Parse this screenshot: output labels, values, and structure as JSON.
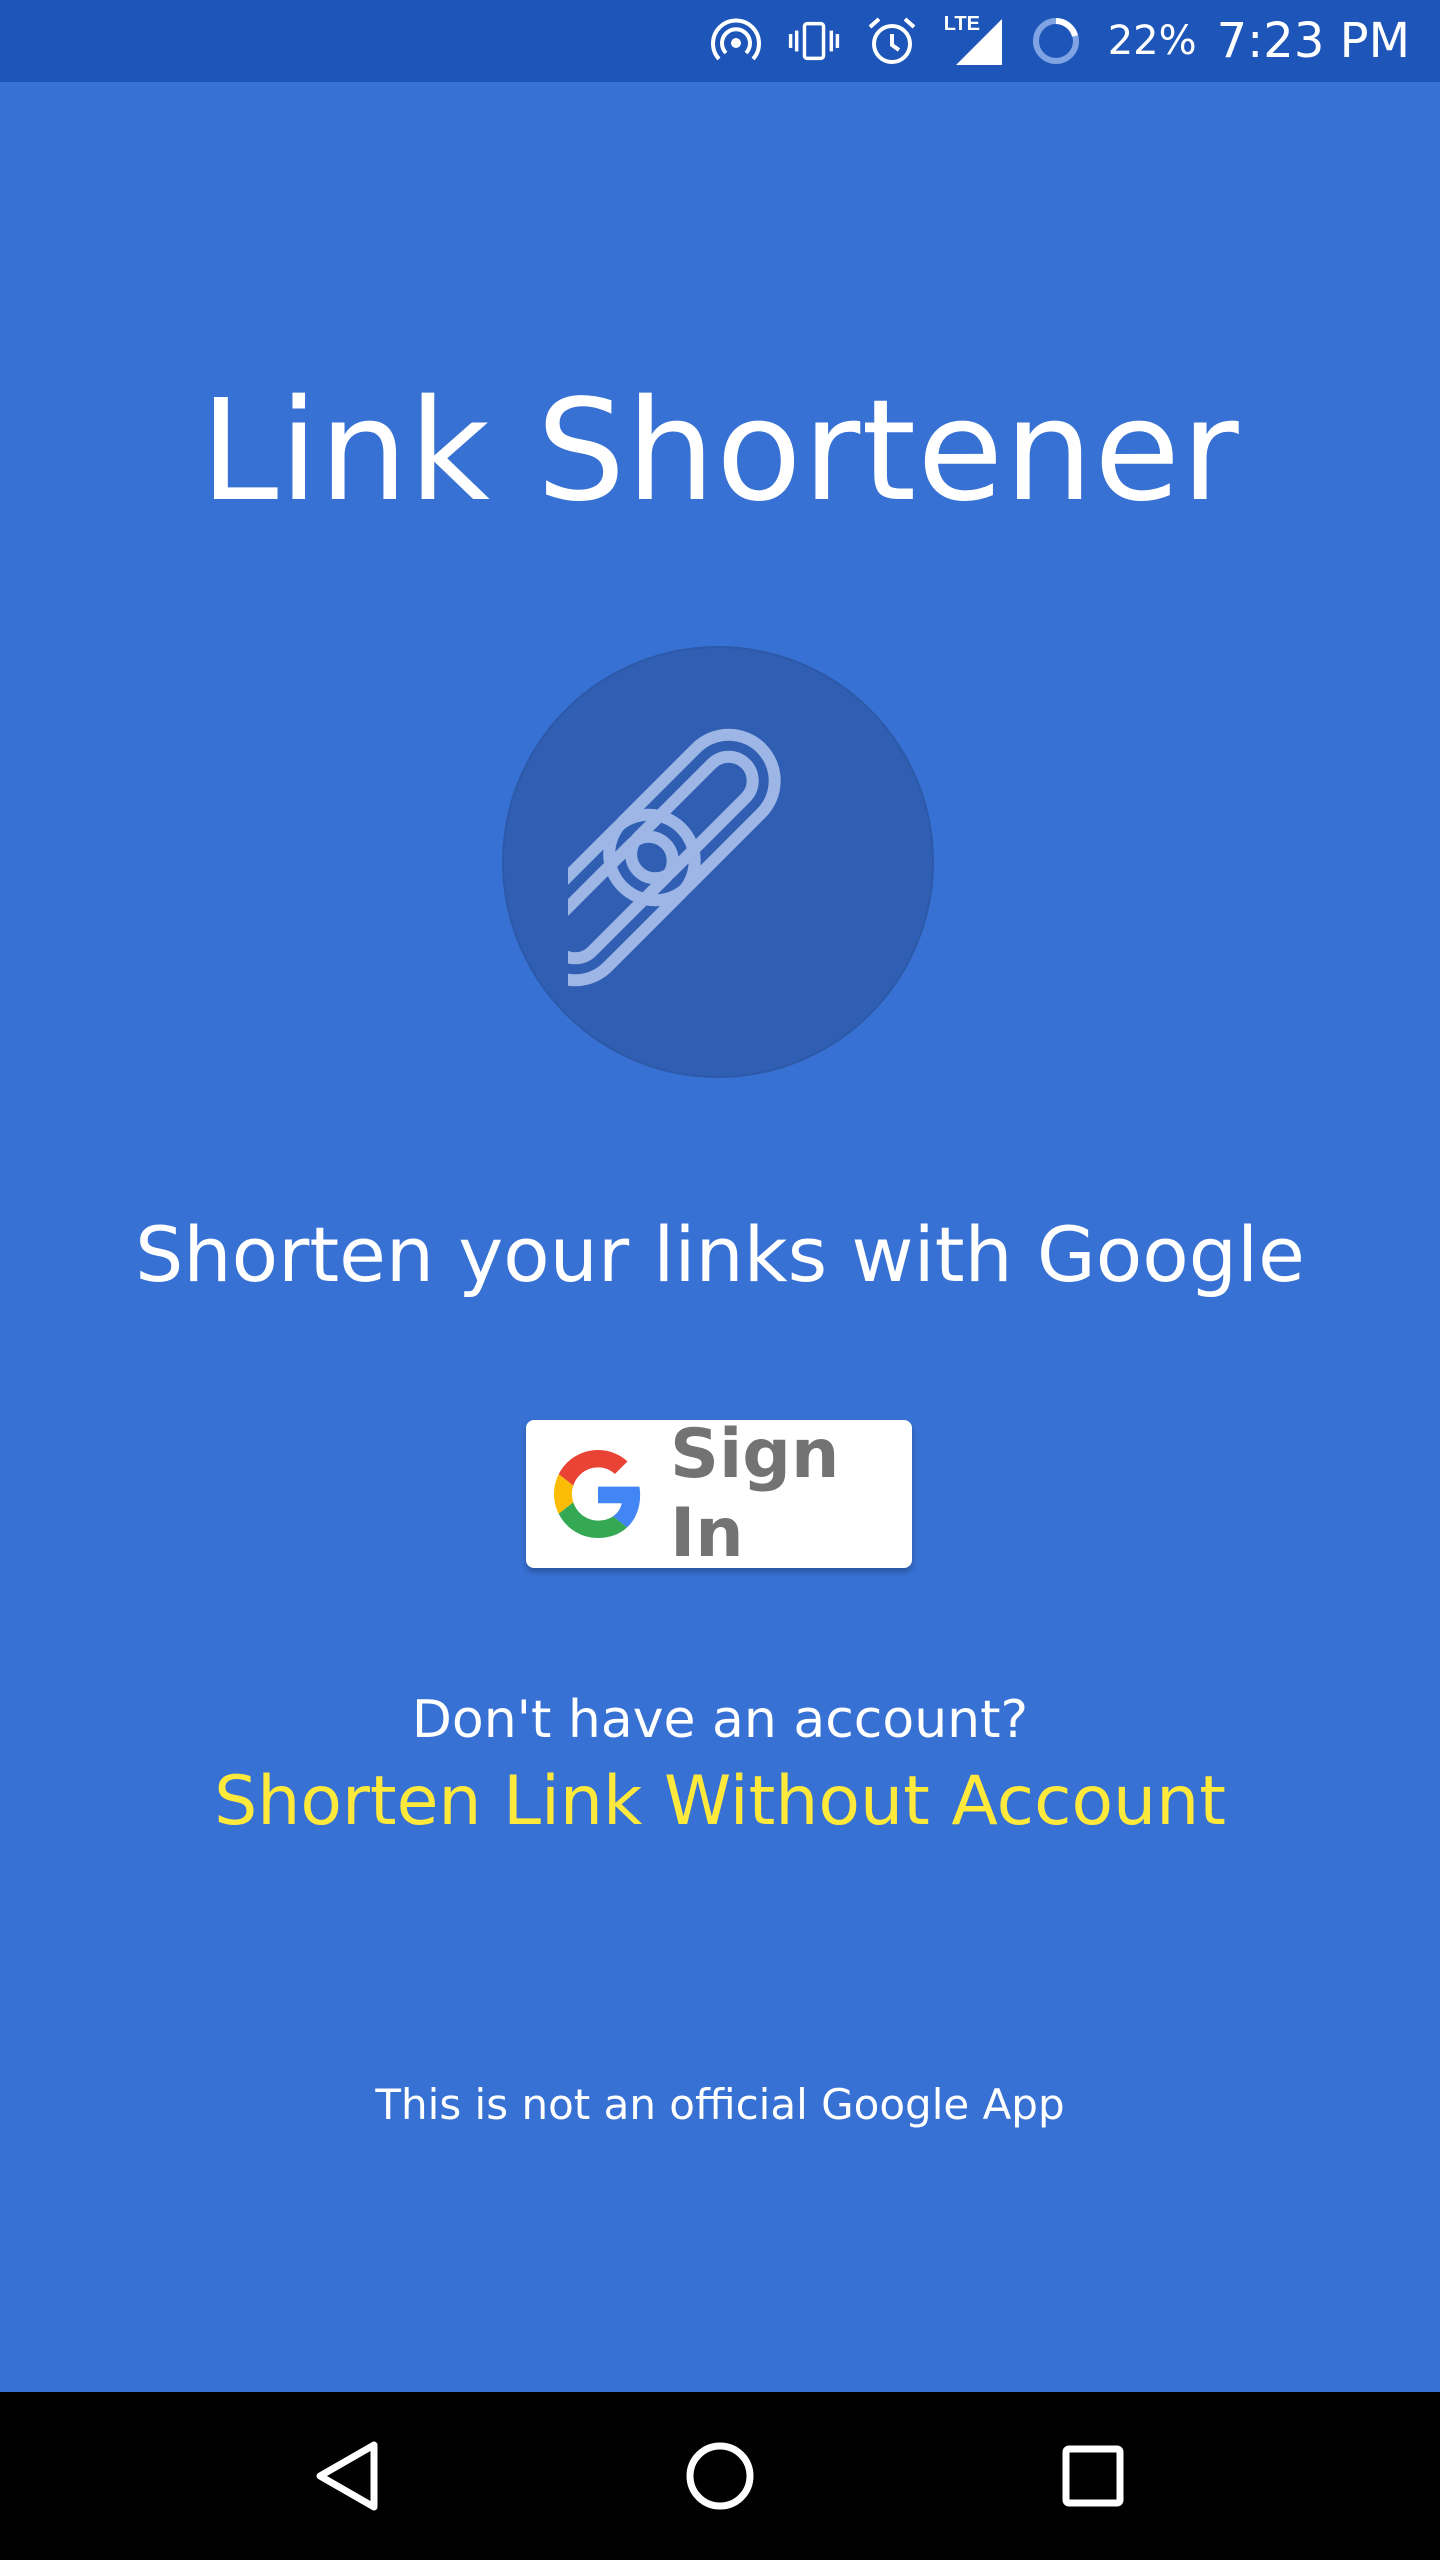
{
  "status_bar": {
    "icons": [
      "hotspot-icon",
      "vibrate-icon",
      "alarm-icon",
      "lte-signal-icon",
      "battery-icon"
    ],
    "network_label": "LTE",
    "battery_percent": "22%",
    "time": "7:23 PM"
  },
  "main": {
    "title": "Link Shortener",
    "logo_icon": "link-chain-icon",
    "tagline": "Shorten your links with Google",
    "signin": {
      "icon": "google-g-icon",
      "label": "Sign In"
    },
    "no_account_prompt": "Don't have an account?",
    "shorten_without_account": "Shorten Link Without Account",
    "disclaimer": "This is not an official Google App"
  },
  "nav_bar": {
    "buttons": [
      "back-icon",
      "home-icon",
      "recents-icon"
    ]
  },
  "colors": {
    "background": "#3871d4",
    "status_bar": "#1d55b8",
    "logo_circle": "#2f5eb2",
    "link_accent": "#ffea3b",
    "signin_text": "#737373",
    "nav_bar": "#000000"
  }
}
